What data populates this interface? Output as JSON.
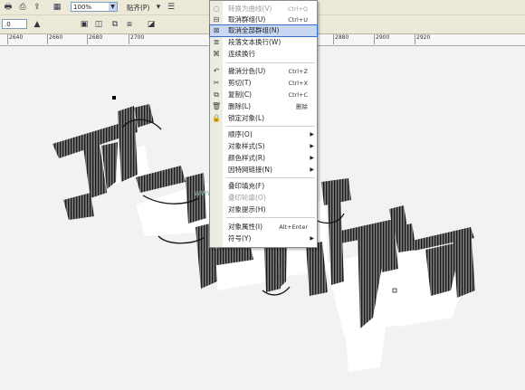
{
  "toolbar": {
    "zoom_value": "100%",
    "snap_label": "贴齐(P)",
    "position_value": ".0"
  },
  "ruler": {
    "ticks": [
      "2640",
      "2660",
      "2680",
      "2700",
      "2880",
      "2900",
      "2920"
    ]
  },
  "context_menu": {
    "items": [
      {
        "icon": "curve-icon",
        "label": "转换为曲线(V)",
        "shortcut": "Ctrl+Q",
        "disabled": true
      },
      {
        "icon": "ungroup-icon",
        "label": "取消群组(U)",
        "shortcut": "Ctrl+U"
      },
      {
        "icon": "ungroup-all-icon",
        "label": "取消全部群组(N)",
        "shortcut": "",
        "highlighted": true
      },
      {
        "icon": "text-wrap-icon",
        "label": "段落文本换行(W)",
        "shortcut": ""
      },
      {
        "icon": "link-icon",
        "label": "连续换行",
        "shortcut": ""
      },
      {
        "icon": "undo-icon",
        "label": "撤消分色(U)",
        "shortcut": "Ctrl+Z"
      },
      {
        "icon": "scissors-icon",
        "label": "剪切(T)",
        "shortcut": "Ctrl+X"
      },
      {
        "icon": "copy-icon",
        "label": "复制(C)",
        "shortcut": "Ctrl+C"
      },
      {
        "icon": "trash-icon",
        "label": "删除(L)",
        "shortcut": "删除"
      },
      {
        "icon": "lock-icon",
        "label": "锁定对象(L)",
        "shortcut": ""
      },
      {
        "icon": "",
        "label": "顺序(O)",
        "shortcut": "",
        "submenu": true
      },
      {
        "icon": "",
        "label": "对象样式(S)",
        "shortcut": "",
        "submenu": true
      },
      {
        "icon": "",
        "label": "颜色样式(R)",
        "shortcut": "",
        "submenu": true
      },
      {
        "icon": "",
        "label": "因特网链接(N)",
        "shortcut": "",
        "submenu": true
      },
      {
        "icon": "",
        "label": "叠印填充(F)",
        "shortcut": ""
      },
      {
        "icon": "",
        "label": "叠印轮廓(O)",
        "shortcut": "",
        "disabled": true
      },
      {
        "icon": "",
        "label": "对象提示(H)",
        "shortcut": ""
      },
      {
        "icon": "",
        "label": "对象属性(I)",
        "shortcut": "Alt+Enter"
      },
      {
        "icon": "",
        "label": "符号(Y)",
        "shortcut": "",
        "submenu": true
      }
    ]
  },
  "watermark": "www.jb51.net"
}
